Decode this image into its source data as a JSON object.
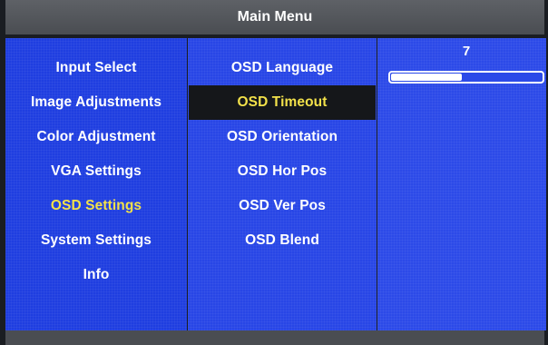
{
  "header": {
    "title": "Main Menu"
  },
  "main_menu": {
    "items": [
      {
        "label": "Input Select"
      },
      {
        "label": "Image Adjustments"
      },
      {
        "label": "Color Adjustment"
      },
      {
        "label": "VGA Settings"
      },
      {
        "label": "OSD Settings",
        "active": true
      },
      {
        "label": "System Settings"
      },
      {
        "label": "Info"
      }
    ]
  },
  "osd_submenu": {
    "items": [
      {
        "label": "OSD Language"
      },
      {
        "label": "OSD Timeout",
        "selected": true
      },
      {
        "label": "OSD Orientation"
      },
      {
        "label": "OSD Hor Pos"
      },
      {
        "label": "OSD Ver Pos"
      },
      {
        "label": "OSD Blend"
      }
    ]
  },
  "value_panel": {
    "value": "7",
    "slider_fraction": 0.47
  },
  "colors": {
    "menu_blue": "#1f3ee0",
    "highlight_text": "#f2e14a",
    "selected_bg": "#15171a",
    "title_bar": "#5e6166"
  }
}
